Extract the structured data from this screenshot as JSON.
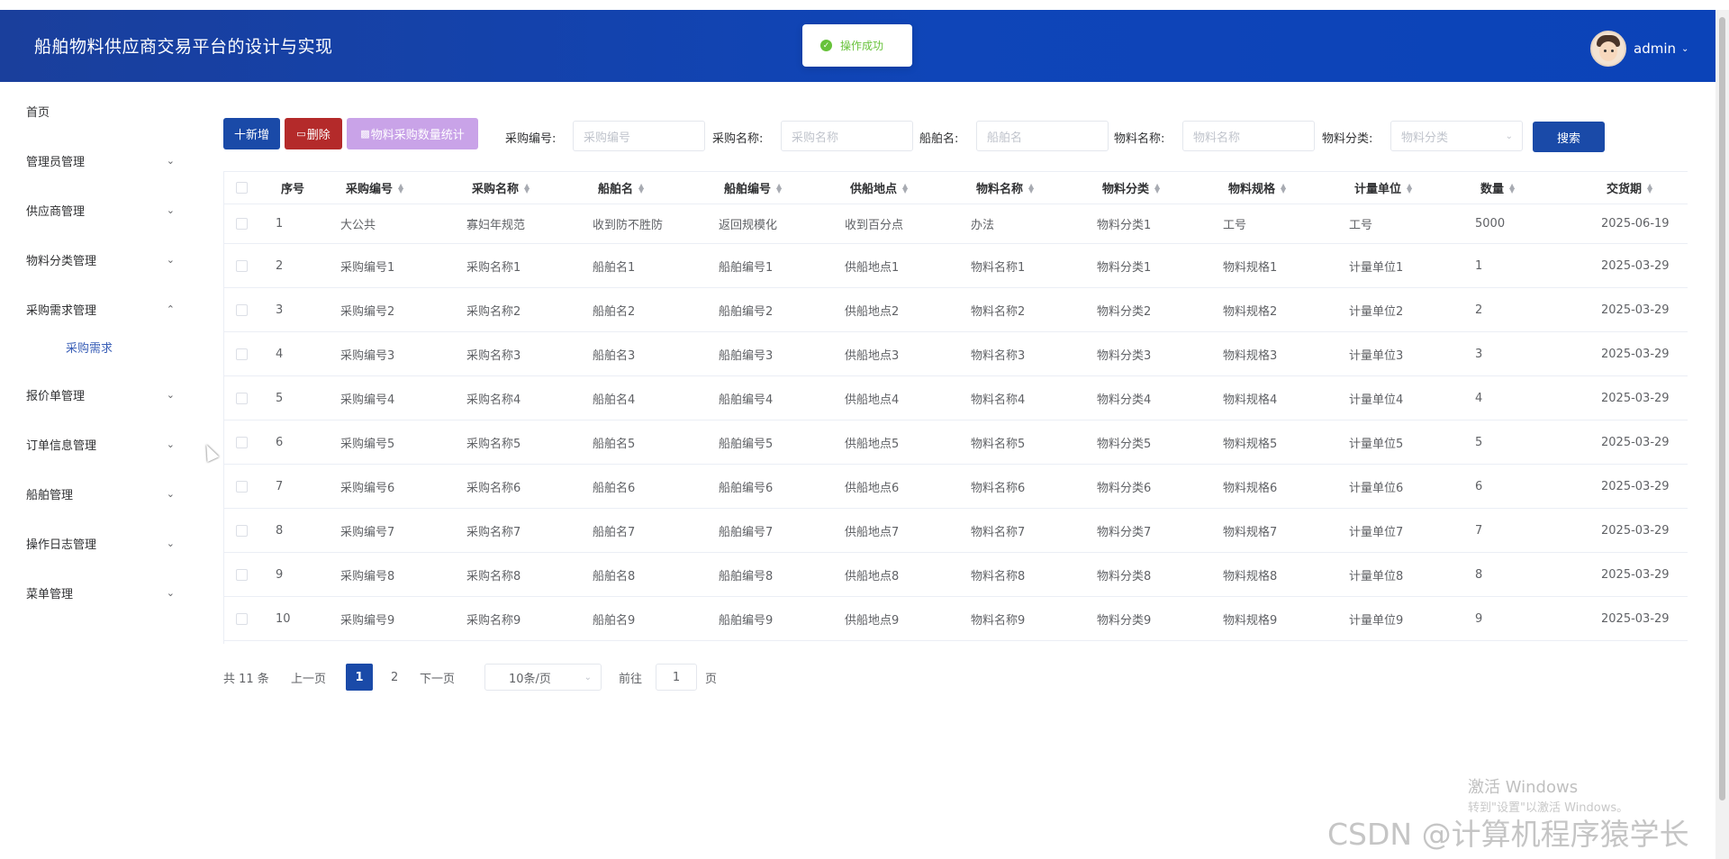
{
  "app": {
    "title": "船舶物料供应商交易平台的设计与实现"
  },
  "toast": {
    "text": "操作成功",
    "icon": "check-circle-icon",
    "color": "#67c23a"
  },
  "user": {
    "name": "admin"
  },
  "sidebar": {
    "items": [
      {
        "label": "首页"
      },
      {
        "label": "管理员管理"
      },
      {
        "label": "供应商管理"
      },
      {
        "label": "物料分类管理"
      },
      {
        "label": "采购需求管理"
      },
      {
        "label": "报价单管理"
      },
      {
        "label": "订单信息管理"
      },
      {
        "label": "船舶管理"
      },
      {
        "label": "操作日志管理"
      },
      {
        "label": "菜单管理"
      }
    ],
    "sub_item": "采购需求"
  },
  "toolbar": {
    "add_label": "十新增",
    "delete_label": "删除",
    "stat_label": "物料采购数量统计",
    "search_label": "搜索"
  },
  "filters": {
    "purchase_no_label": "采购编号:",
    "purchase_no_placeholder": "采购编号",
    "purchase_name_label": "采购名称:",
    "purchase_name_placeholder": "采购名称",
    "ship_name_label": "船舶名:",
    "ship_name_placeholder": "船舶名",
    "material_name_label": "物料名称:",
    "material_name_placeholder": "物料名称",
    "material_cat_label": "物料分类:",
    "material_cat_placeholder": "物料分类"
  },
  "table": {
    "columns": [
      "序号",
      "采购编号",
      "采购名称",
      "船舶名",
      "船舶编号",
      "供船地点",
      "物料名称",
      "物料分类",
      "物料规格",
      "计量单位",
      "数量",
      "交货期"
    ],
    "rows": [
      [
        "1",
        "大公共",
        "寡妇年规范",
        "收到防不胜防",
        "返回规模化",
        "收到百分点",
        "办法",
        "物料分类1",
        "工号",
        "工号",
        "5000",
        "2025-06-19"
      ],
      [
        "2",
        "采购编号1",
        "采购名称1",
        "船舶名1",
        "船舶编号1",
        "供船地点1",
        "物料名称1",
        "物料分类1",
        "物料规格1",
        "计量单位1",
        "1",
        "2025-03-29"
      ],
      [
        "3",
        "采购编号2",
        "采购名称2",
        "船舶名2",
        "船舶编号2",
        "供船地点2",
        "物料名称2",
        "物料分类2",
        "物料规格2",
        "计量单位2",
        "2",
        "2025-03-29"
      ],
      [
        "4",
        "采购编号3",
        "采购名称3",
        "船舶名3",
        "船舶编号3",
        "供船地点3",
        "物料名称3",
        "物料分类3",
        "物料规格3",
        "计量单位3",
        "3",
        "2025-03-29"
      ],
      [
        "5",
        "采购编号4",
        "采购名称4",
        "船舶名4",
        "船舶编号4",
        "供船地点4",
        "物料名称4",
        "物料分类4",
        "物料规格4",
        "计量单位4",
        "4",
        "2025-03-29"
      ],
      [
        "6",
        "采购编号5",
        "采购名称5",
        "船舶名5",
        "船舶编号5",
        "供船地点5",
        "物料名称5",
        "物料分类5",
        "物料规格5",
        "计量单位5",
        "5",
        "2025-03-29"
      ],
      [
        "7",
        "采购编号6",
        "采购名称6",
        "船舶名6",
        "船舶编号6",
        "供船地点6",
        "物料名称6",
        "物料分类6",
        "物料规格6",
        "计量单位6",
        "6",
        "2025-03-29"
      ],
      [
        "8",
        "采购编号7",
        "采购名称7",
        "船舶名7",
        "船舶编号7",
        "供船地点7",
        "物料名称7",
        "物料分类7",
        "物料规格7",
        "计量单位7",
        "7",
        "2025-03-29"
      ],
      [
        "9",
        "采购编号8",
        "采购名称8",
        "船舶名8",
        "船舶编号8",
        "供船地点8",
        "物料名称8",
        "物料分类8",
        "物料规格8",
        "计量单位8",
        "8",
        "2025-03-29"
      ],
      [
        "10",
        "采购编号9",
        "采购名称9",
        "船舶名9",
        "船舶编号9",
        "供船地点9",
        "物料名称9",
        "物料分类9",
        "物料规格9",
        "计量单位9",
        "9",
        "2025-03-29"
      ]
    ]
  },
  "pagination": {
    "total": "共 11 条",
    "prev": "上一页",
    "pages": [
      "1",
      "2"
    ],
    "current": "1",
    "next": "下一页",
    "page_size": "10条/页",
    "goto_label": "前往",
    "goto_value": "1",
    "goto_suffix": "页"
  },
  "watermark": {
    "activate_title": "激活 Windows",
    "activate_sub": "转到\"设置\"以激活 Windows。",
    "csdn": "CSDN @计算机程序猿学长"
  },
  "colors": {
    "primary": "#1a4aa8",
    "danger": "#b42a2a",
    "stat": "#c9a3e8",
    "header_bg": "#0f45b8"
  }
}
